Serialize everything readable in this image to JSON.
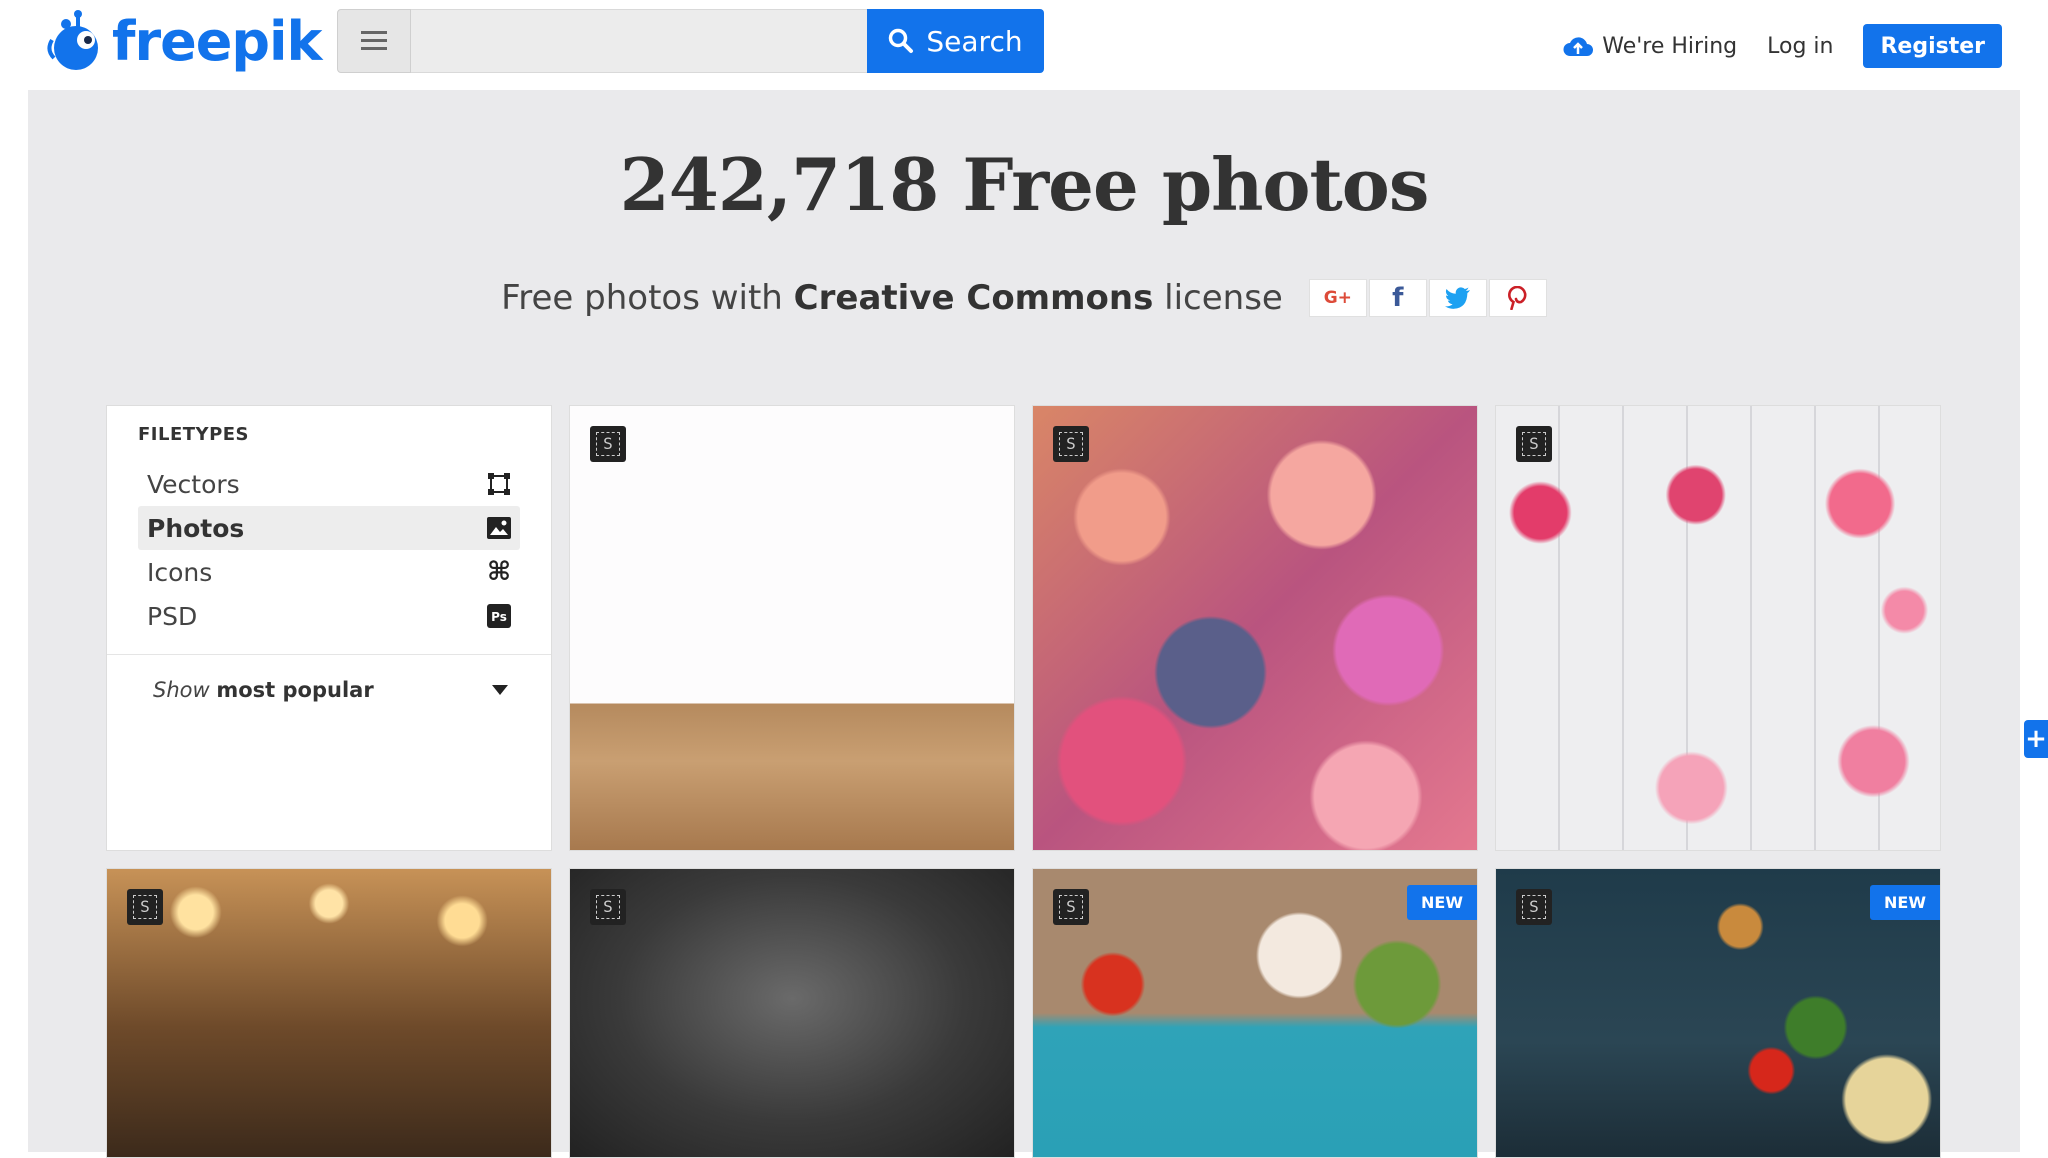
{
  "header": {
    "logo_text": "freepik",
    "search_placeholder": "",
    "search_label": "Search",
    "hiring_label": "We're Hiring",
    "login_label": "Log in",
    "register_label": "Register"
  },
  "hero": {
    "title": "242,718 Free photos",
    "subtitle_prefix": "Free photos with ",
    "subtitle_bold": "Creative Commons",
    "subtitle_suffix": " license",
    "social": [
      {
        "label": "G+",
        "color": "#dd4b39"
      },
      {
        "label": "f",
        "color": "#3b5998"
      },
      {
        "label": "",
        "color": "#1da1f2"
      },
      {
        "label": "",
        "color": "#cb2027"
      }
    ]
  },
  "filters": {
    "heading": "FILETYPES",
    "items": [
      {
        "label": "Vectors",
        "active": false
      },
      {
        "label": "Photos",
        "active": true
      },
      {
        "label": "Icons",
        "active": false
      },
      {
        "label": "PSD",
        "active": false
      }
    ],
    "sort_prefix": "Show",
    "sort_value": "most popular"
  },
  "tiles": [
    {
      "badge": "S",
      "new": false
    },
    {
      "badge": "S",
      "new": false
    },
    {
      "badge": "S",
      "new": false
    },
    {
      "badge": "S",
      "new": false
    },
    {
      "badge": "S",
      "new": false
    },
    {
      "badge": "S",
      "new": true,
      "new_label": "NEW"
    },
    {
      "badge": "S",
      "new": true,
      "new_label": "NEW"
    }
  ],
  "colors": {
    "brand": "#1273eb",
    "background": "#eaeaec"
  }
}
